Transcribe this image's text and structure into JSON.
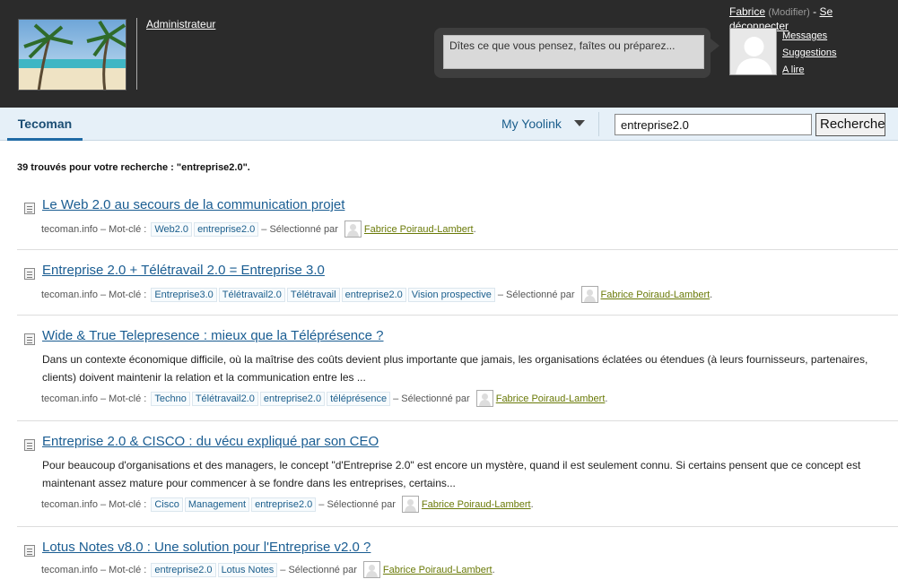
{
  "header": {
    "role_link": "Administrateur",
    "status_placeholder": "Dîtes ce que vous pensez, faîtes ou préparez...",
    "user": {
      "name": "Fabrice",
      "modify": "(Modifier)",
      "separator": " - ",
      "logout": "Se déconnecter"
    },
    "links": [
      "Messages",
      "Suggestions",
      "A lire"
    ]
  },
  "nav": {
    "active_tab": "Tecoman",
    "my_menu": "My Yoolink",
    "search_value": "entreprise2.0",
    "search_button": "Rechercher"
  },
  "results_summary": "39 trouvés pour votre recherche : \"entreprise2.0\".",
  "meta_labels": {
    "source": "tecoman.info",
    "keyword": "– Mot-clé :",
    "selected_by": "– Sélectionné par",
    "author": "Fabrice Poiraud-Lambert"
  },
  "results": [
    {
      "title": "Le Web 2.0 au secours de la communication projet",
      "excerpt": "",
      "tags": [
        "Web2.0",
        "entreprise2.0"
      ]
    },
    {
      "title": "Entreprise 2.0 + Télétravail 2.0 = Entreprise 3.0",
      "excerpt": "",
      "tags": [
        "Entreprise3.0",
        "Télétravail2.0",
        "Télétravail",
        "entreprise2.0",
        "Vision prospective"
      ]
    },
    {
      "title": "Wide & True Telepresence : mieux que la Téléprésence ?",
      "excerpt": "Dans un contexte économique difficile, où la maîtrise des coûts devient plus importante que jamais, les organisations éclatées ou étendues (à leurs fournisseurs, partenaires, clients) doivent maintenir la relation et la communication entre les ...",
      "tags": [
        "Techno",
        "Télétravail2.0",
        "entreprise2.0",
        "téléprésence"
      ]
    },
    {
      "title": "Entreprise 2.0 & CISCO : du vécu expliqué par son CEO",
      "excerpt": "Pour beaucoup d'organisations et des managers, le concept \"d'Entreprise 2.0\" est encore un mystère, quand il est seulement connu. Si certains pensent que ce concept est maintenant assez mature pour commencer à se fondre dans les entreprises, certains...",
      "tags": [
        "Cisco",
        "Management",
        "entreprise2.0"
      ]
    },
    {
      "title": "Lotus Notes v8.0 : Une solution pour l'Entreprise v2.0 ?",
      "excerpt": "",
      "tags": [
        "entreprise2.0",
        "Lotus Notes"
      ]
    }
  ],
  "colors": {
    "header_bg": "#2b2b2b",
    "nav_bg": "#e6f0f8",
    "link_blue": "#1a5d92",
    "author_green": "#6a7a08"
  },
  "icons": {
    "logo": "beach-logo-image",
    "avatar": "default-user-avatar-icon",
    "result": "document-icon",
    "dropdown": "chevron-down-icon"
  }
}
